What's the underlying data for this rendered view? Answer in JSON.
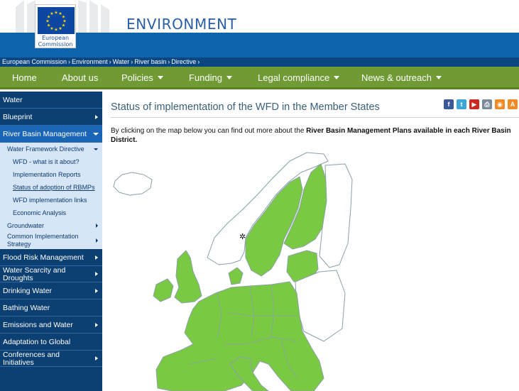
{
  "header": {
    "logo_text_line1": "European",
    "logo_text_line2": "Commission",
    "site_title": "ENVIRONMENT"
  },
  "breadcrumb": [
    "European Commission",
    "Environment",
    "Water",
    "River basin",
    "Directive"
  ],
  "breadcrumb_sep": "›",
  "nav": [
    {
      "label": "Home",
      "dropdown": false
    },
    {
      "label": "About us",
      "dropdown": false
    },
    {
      "label": "Policies",
      "dropdown": true
    },
    {
      "label": "Funding",
      "dropdown": true
    },
    {
      "label": "Legal compliance",
      "dropdown": true
    },
    {
      "label": "News & outreach",
      "dropdown": true
    }
  ],
  "sidebar": {
    "items_top": [
      "Water",
      "Blueprint"
    ],
    "active_section": "River Basin Management",
    "submenu": [
      {
        "label": "Water Framework Directive"
      },
      {
        "label": "WFD - what is it about?"
      },
      {
        "label": "Implementation Reports"
      },
      {
        "label": "Status of adoption of RBMPs"
      },
      {
        "label": "WFD implementation links"
      },
      {
        "label": "Economic Analysis"
      },
      {
        "label": "Groundwater"
      },
      {
        "label": "Common Implementation Strategy"
      }
    ],
    "items_bottom": [
      {
        "label": "Flood Risk Management"
      },
      {
        "label": "Water Scarcity and Droughts"
      },
      {
        "label": "Drinking Water"
      },
      {
        "label": "Bathing Water"
      },
      {
        "label": "Emissions and Water Reuse"
      },
      {
        "label": "Adaptation to Global Change"
      },
      {
        "label": "Conferences and Initiatives"
      }
    ]
  },
  "content": {
    "title": "Status of implementation of the WFD in the Member States",
    "intro_plain": "By clicking on the map below you can find out more about the ",
    "intro_bold": "River Basin Management Plans available in each River Basin District."
  },
  "share_icons": [
    {
      "name": "facebook-icon",
      "glyph": "f",
      "color": "#3b5998"
    },
    {
      "name": "twitter-icon",
      "glyph": "t",
      "color": "#3ca6d8"
    },
    {
      "name": "youtube-icon",
      "glyph": "▶",
      "color": "#cc2a21"
    },
    {
      "name": "print-icon",
      "glyph": "⎙",
      "color": "#7a8a99"
    },
    {
      "name": "rss-icon",
      "glyph": "◉",
      "color": "#f08a24"
    },
    {
      "name": "text-size-icon",
      "glyph": "A",
      "color": "#f08a24"
    }
  ],
  "colors": {
    "map_member_state": "#7ac943",
    "map_non_member": "#ffffff",
    "map_border": "#8aa0a8",
    "nav_green": "#6f9a34",
    "header_blue": "#0e63ad",
    "sidebar_navy": "#0c3f72"
  }
}
